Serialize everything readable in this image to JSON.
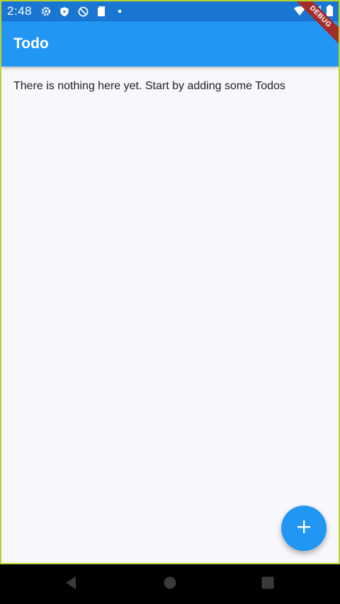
{
  "status_bar": {
    "time": "2:48",
    "icons_left": [
      "gear-icon",
      "shield-icon",
      "no-sync-icon",
      "sd-card-icon",
      "dot-icon"
    ],
    "icons_right": [
      "wifi-icon",
      "signal-icon",
      "battery-icon"
    ],
    "background_color": "#1976d2"
  },
  "debug_banner": {
    "label": "DEBUG",
    "color": "#a32c2c"
  },
  "app_bar": {
    "title": "Todo",
    "background_color": "#2196f3"
  },
  "main": {
    "empty_message": "There is nothing here yet. Start by adding some Todos"
  },
  "fab": {
    "icon": "plus-icon",
    "color": "#2196f3"
  },
  "nav_bar": {
    "buttons": [
      "back-icon",
      "home-icon",
      "recents-icon"
    ]
  }
}
